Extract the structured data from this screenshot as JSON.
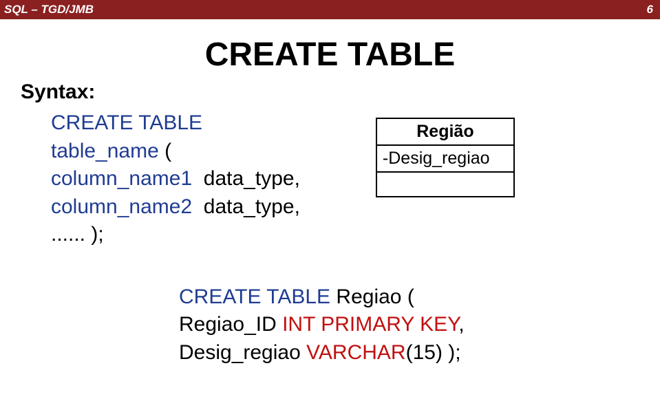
{
  "header": {
    "left": "SQL – TGD/JMB",
    "right": "6"
  },
  "title": "CREATE TABLE",
  "syntax": {
    "label": "Syntax:",
    "keyword": "CREATE TABLE",
    "tablename": "table_name",
    "open": " (",
    "col1": "column_name1",
    "col2": "column_name2",
    "datatype": "data_type,",
    "end": "...... );"
  },
  "diagram": {
    "header": "Região",
    "field": "-Desig_regiao"
  },
  "example": {
    "create_table": "CREATE TABLE",
    "table_name": " Regiao (",
    "col1_name": "Regiao_ID ",
    "col1_type": "INT PRIMARY KEY",
    "comma": ",",
    "col2_name": "Desig_regiao ",
    "col2_type": "VARCHAR",
    "col2_size": "(15) );"
  }
}
